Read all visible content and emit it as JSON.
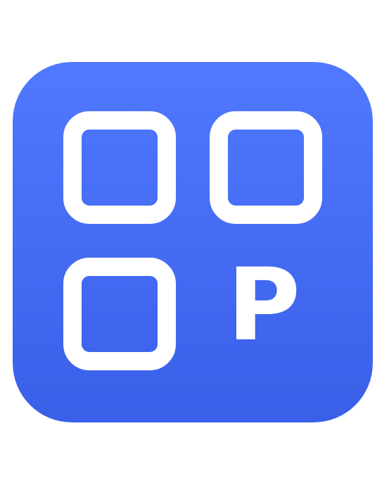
{
  "app_icon": {
    "name": "app-grid-icon",
    "glyph_letter": "P",
    "colors": {
      "gradient_top": "#5079ff",
      "gradient_bottom": "#3a5fe8",
      "foreground": "#ffffff",
      "page_background": "#ffffff"
    },
    "tiles": [
      {
        "name": "square-tile-top-left"
      },
      {
        "name": "square-tile-top-right"
      },
      {
        "name": "square-tile-bottom-left"
      }
    ]
  }
}
